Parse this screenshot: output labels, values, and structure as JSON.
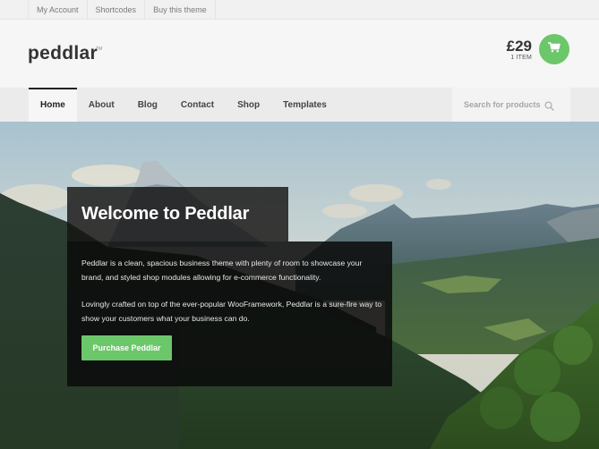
{
  "topbar": {
    "links": [
      {
        "label": "My Account"
      },
      {
        "label": "Shortcodes"
      },
      {
        "label": "Buy this theme"
      }
    ]
  },
  "header": {
    "logo": "peddlar",
    "logo_mark": "TM",
    "cart": {
      "amount": "£29",
      "count": "1 ITEM",
      "icon": "shopping-cart-icon",
      "accent_color": "#6cc76a"
    }
  },
  "nav": {
    "items": [
      {
        "label": "Home",
        "active": true
      },
      {
        "label": "About"
      },
      {
        "label": "Blog"
      },
      {
        "label": "Contact"
      },
      {
        "label": "Shop"
      },
      {
        "label": "Templates"
      }
    ],
    "search": {
      "placeholder": "Search for products",
      "value": "",
      "icon": "search-icon"
    }
  },
  "hero": {
    "title": "Welcome to Peddlar",
    "paragraphs": [
      "Peddlar is a clean, spacious business theme with plenty of room to showcase your brand, and styled shop modules allowing for e-commerce functionality.",
      "Lovingly crafted on top of the ever-popular WooFramework, Peddlar is a sure-fire way to show your customers what your business can do."
    ],
    "cta_label": "Purchase Peddlar",
    "cta_color": "#6cc76a",
    "background": "mountain-valley-landscape"
  }
}
